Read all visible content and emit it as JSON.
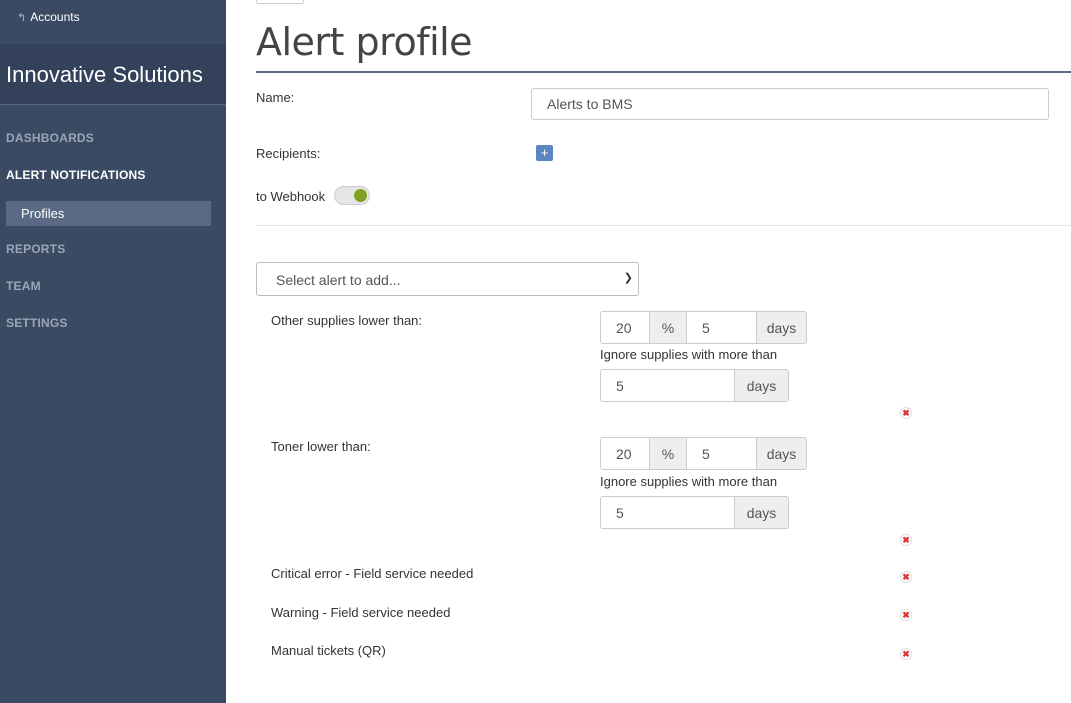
{
  "sidebar": {
    "accounts_link": "Accounts",
    "company": "Innovative Solutions",
    "nav": {
      "dashboards": "DASHBOARDS",
      "alert_notifications": "ALERT NOTIFICATIONS",
      "profiles": "Profiles",
      "reports": "REPORTS",
      "team": "TEAM",
      "settings": "SETTINGS"
    }
  },
  "main": {
    "title": "Alert profile",
    "name_label": "Name:",
    "name_value": "Alerts to BMS",
    "recipients_label": "Recipients:",
    "add_recipient": "+",
    "webhook_label": "to Webhook",
    "webhook_enabled": true,
    "select_placeholder": "Select alert to add...",
    "alerts": [
      {
        "label": "Other supplies lower than:",
        "percent": "20",
        "percent_unit": "%",
        "days": "5",
        "days_unit": "days",
        "ignore_label": "Ignore supplies with more than",
        "ignore_days": "5",
        "ignore_unit": "days"
      },
      {
        "label": "Toner lower than:",
        "percent": "20",
        "percent_unit": "%",
        "days": "5",
        "days_unit": "days",
        "ignore_label": "Ignore supplies with more than",
        "ignore_days": "5",
        "ignore_unit": "days"
      },
      {
        "label": "Critical error - Field service needed"
      },
      {
        "label": "Warning - Field service needed"
      },
      {
        "label": "Manual tickets (QR)"
      }
    ],
    "remove_glyph": "✖",
    "colors": {
      "sidebar_bg": "#3a4a63",
      "active_sub_bg": "#5a6a85",
      "toggle_on": "#7ea21f",
      "add_button": "#5d85c4",
      "remove_icon": "#dd3333"
    }
  }
}
